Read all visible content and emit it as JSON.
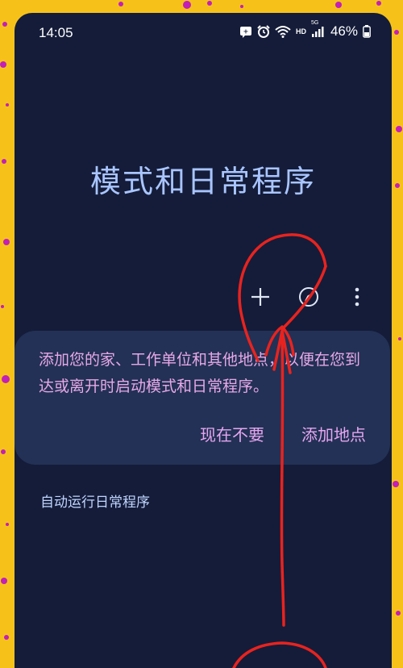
{
  "status_bar": {
    "time": "14:05",
    "network_label": "HD",
    "network_gen": "5G",
    "battery_percent": "46%",
    "icons": [
      "notification-icon",
      "alarm-icon",
      "wifi-icon",
      "signal-icon",
      "battery-icon"
    ]
  },
  "page": {
    "title": "模式和日常程序"
  },
  "toolbar": {
    "icons": [
      "add-icon",
      "compass-icon",
      "more-vert-icon"
    ]
  },
  "card": {
    "message": "添加您的家、工作单位和其他地点，以便在您到达或离开时启动模式和日常程序。",
    "dismiss_label": "现在不要",
    "add_location_label": "添加地点"
  },
  "section": {
    "routines_label": "自动运行日常程序"
  },
  "colors": {
    "background": "#141c39",
    "card": "#223155",
    "title": "#a9c5ff",
    "card_text": "#e8a8e8",
    "frame": "#f6c21a",
    "annotation": "#e8231f"
  }
}
